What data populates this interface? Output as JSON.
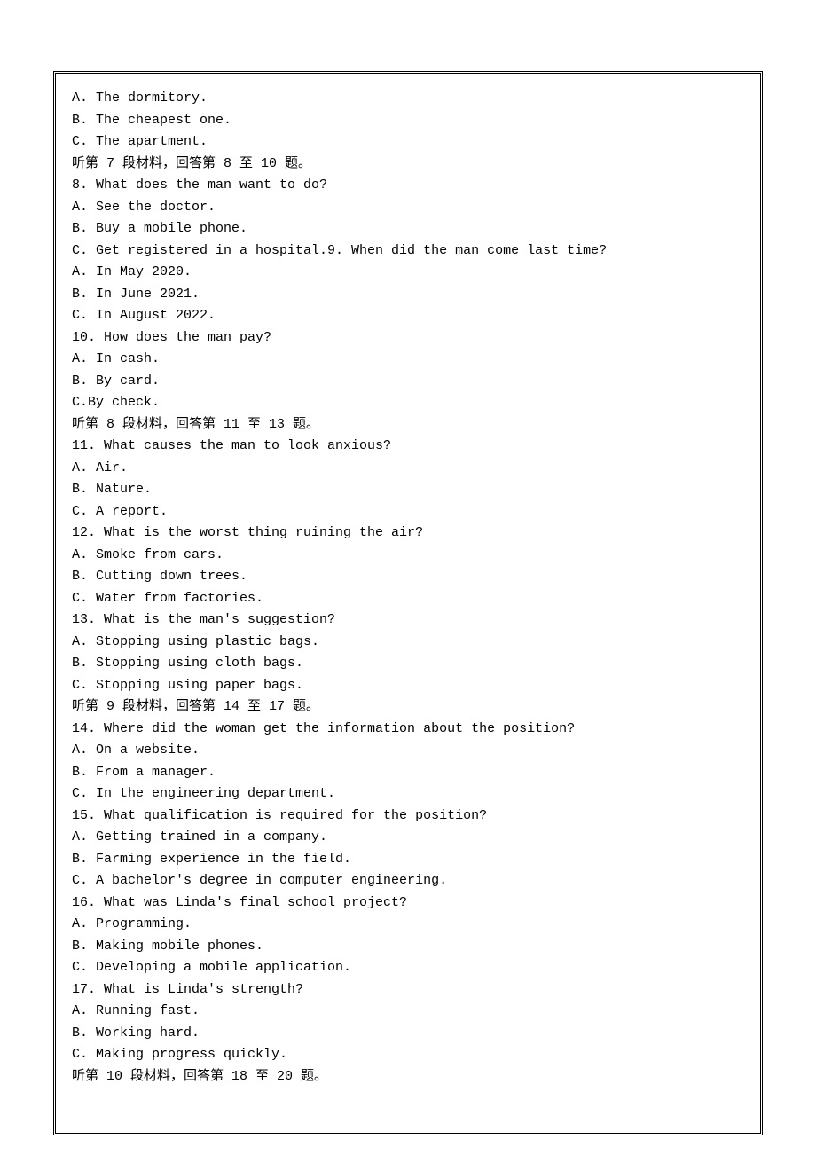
{
  "lines": [
    {
      "t": "A. The dormitory.",
      "cls": "mono"
    },
    {
      "t": "B. The cheapest one.",
      "cls": "mono"
    },
    {
      "t": "C. The apartment.",
      "cls": "mono"
    },
    {
      "t": "听第 7 段材料，回答第 8 至 10 题。",
      "cls": ""
    },
    {
      "t": "8. What does the man want to do?",
      "cls": "mono"
    },
    {
      "t": "A. See the doctor.",
      "cls": "mono"
    },
    {
      "t": "B. Buy a mobile phone.",
      "cls": "mono"
    },
    {
      "t": "C. Get registered in a hospital.9. When did the man come last time?",
      "cls": "mono"
    },
    {
      "t": "A. In May 2020.",
      "cls": "mono"
    },
    {
      "t": "B. In June 2021.",
      "cls": "mono"
    },
    {
      "t": "C. In August 2022.",
      "cls": "mono"
    },
    {
      "t": "10. How does the man pay?",
      "cls": "mono"
    },
    {
      "t": "A. In cash.",
      "cls": "mono"
    },
    {
      "t": "B. By card.",
      "cls": "mono"
    },
    {
      "t": "C.By check.",
      "cls": "mono"
    },
    {
      "t": "听第 8 段材料，回答第 11 至 13 题。",
      "cls": ""
    },
    {
      "t": "11. What causes the man to look anxious?",
      "cls": "mono"
    },
    {
      "t": "A. Air.",
      "cls": "mono"
    },
    {
      "t": "B. Nature.",
      "cls": "mono"
    },
    {
      "t": "C. A report.",
      "cls": "mono"
    },
    {
      "t": "12. What is the worst thing ruining the air?",
      "cls": "mono"
    },
    {
      "t": "A. Smoke from cars.",
      "cls": "mono"
    },
    {
      "t": "B. Cutting down trees.",
      "cls": "mono"
    },
    {
      "t": "C. Water from factories.",
      "cls": "mono"
    },
    {
      "t": "13. What is the man's suggestion?",
      "cls": "mono"
    },
    {
      "t": "A. Stopping using plastic bags.",
      "cls": "mono"
    },
    {
      "t": "B. Stopping using cloth bags.",
      "cls": "mono"
    },
    {
      "t": "C. Stopping using paper bags.",
      "cls": "mono"
    },
    {
      "t": "听第 9 段材料，回答第 14 至 17 题。",
      "cls": ""
    },
    {
      "t": "14. Where did the woman get the information about the position?",
      "cls": "mono"
    },
    {
      "t": "A. On a website.",
      "cls": "mono"
    },
    {
      "t": "B. From a manager.",
      "cls": "mono"
    },
    {
      "t": "C. In the engineering department.",
      "cls": "mono"
    },
    {
      "t": "15. What qualification is required for the position?",
      "cls": "mono"
    },
    {
      "t": "A. Getting trained in a company.",
      "cls": "mono"
    },
    {
      "t": "B. Farming experience in the field.",
      "cls": "mono"
    },
    {
      "t": "C. A bachelor's degree in computer engineering.",
      "cls": "mono"
    },
    {
      "t": "16. What was Linda's final school project?",
      "cls": "mono"
    },
    {
      "t": "A. Programming.",
      "cls": "mono"
    },
    {
      "t": "B. Making mobile phones.",
      "cls": "mono"
    },
    {
      "t": "C. Developing a mobile application.",
      "cls": "mono"
    },
    {
      "t": "17. What is Linda's strength?",
      "cls": "mono"
    },
    {
      "t": "A. Running fast.",
      "cls": "mono"
    },
    {
      "t": "B. Working hard.",
      "cls": "mono"
    },
    {
      "t": "C. Making progress quickly.",
      "cls": "mono"
    },
    {
      "t": "听第 10 段材料，回答第 18 至 20 题。",
      "cls": ""
    }
  ]
}
